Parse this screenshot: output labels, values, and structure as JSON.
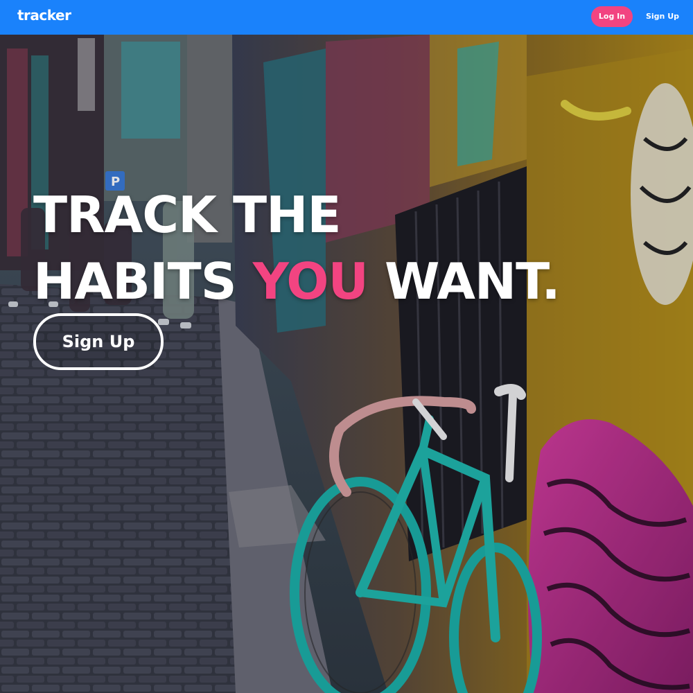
{
  "nav": {
    "brand": "tracker",
    "login_label": "Log In",
    "signup_label": "Sign Up"
  },
  "hero": {
    "headline_line1": "TRACK THE",
    "headline_line2_start": "HABITS ",
    "headline_accent": "YOU",
    "headline_line2_end": " WANT.",
    "cta_label": "Sign Up"
  },
  "colors": {
    "nav_bg": "#1a82fb",
    "accent_pink": "#f24481",
    "text_white": "#ffffff"
  },
  "icons": {
    "background": "graffiti-alley-bicycle-photo"
  }
}
